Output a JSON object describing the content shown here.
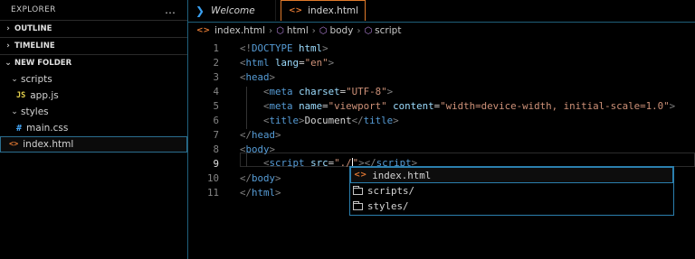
{
  "explorer": {
    "title": "EXPLORER",
    "more_icon": "…",
    "sections": {
      "outline": "OUTLINE",
      "timeline": "TIMELINE",
      "folder": "NEW FOLDER"
    },
    "tree": [
      {
        "label": "scripts",
        "type": "folder"
      },
      {
        "label": "app.js",
        "type": "js",
        "icon": "JS"
      },
      {
        "label": "styles",
        "type": "folder"
      },
      {
        "label": "main.css",
        "type": "css",
        "icon": "#"
      },
      {
        "label": "index.html",
        "type": "html",
        "icon": "<>"
      }
    ]
  },
  "tabs": [
    {
      "label": "Welcome",
      "icon": "vscode-icon"
    },
    {
      "label": "index.html",
      "icon": "html-icon",
      "modified": true
    }
  ],
  "breadcrumb": [
    "index.html",
    "html",
    "body",
    "script"
  ],
  "editor": {
    "lines": [
      {
        "n": "1",
        "html": "<span class='punc'>&lt;!</span><span class='tag'>DOCTYPE</span> <span class='attr'>html</span><span class='punc'>&gt;</span>"
      },
      {
        "n": "2",
        "html": "<span class='punc'>&lt;</span><span class='tag'>html</span> <span class='attr'>lang</span><span class='txt'>=</span><span class='val'>\"en\"</span><span class='punc'>&gt;</span>"
      },
      {
        "n": "3",
        "html": "<span class='punc'>&lt;</span><span class='tag'>head</span><span class='punc'>&gt;</span>"
      },
      {
        "n": "4",
        "html": "    <span class='punc'>&lt;</span><span class='tag'>meta</span> <span class='attr'>charset</span><span class='txt'>=</span><span class='val'>\"UTF-8\"</span><span class='punc'>&gt;</span>"
      },
      {
        "n": "5",
        "html": "    <span class='punc'>&lt;</span><span class='tag'>meta</span> <span class='attr'>name</span><span class='txt'>=</span><span class='val'>\"viewport\"</span> <span class='attr'>content</span><span class='txt'>=</span><span class='val'>\"width=device-width, initial-scale=1.0\"</span><span class='punc'>&gt;</span>"
      },
      {
        "n": "6",
        "html": "    <span class='punc'>&lt;</span><span class='tag'>title</span><span class='punc'>&gt;</span><span class='txt'>Document</span><span class='punc'>&lt;/</span><span class='tag'>title</span><span class='punc'>&gt;</span>"
      },
      {
        "n": "7",
        "html": "<span class='punc'>&lt;/</span><span class='tag'>head</span><span class='punc'>&gt;</span>"
      },
      {
        "n": "8",
        "html": "<span class='punc'>&lt;</span><span class='tag'>body</span><span class='punc'>&gt;</span>"
      },
      {
        "n": "9",
        "html": "    <span class='punc'>&lt;</span><span class='tag'>script</span> <span class='attr'>src</span><span class='txt'>=</span><span class='val'>\"./</span><span class='caret'></span><span class='val'>\"</span><span class='punc'>&gt;&lt;/</span><span class='tag'>script</span><span class='punc'>&gt;</span>"
      },
      {
        "n": "10",
        "html": "<span class='punc'>&lt;/</span><span class='tag'>body</span><span class='punc'>&gt;</span>"
      },
      {
        "n": "11",
        "html": "<span class='punc'>&lt;/</span><span class='tag'>html</span><span class='punc'>&gt;</span>"
      }
    ],
    "current_line": "9"
  },
  "suggestions": [
    {
      "label": "index.html",
      "icon": "html-icon"
    },
    {
      "label": "scripts/",
      "icon": "folder-icon"
    },
    {
      "label": "styles/",
      "icon": "folder-icon"
    }
  ],
  "colors": {
    "accent_border": "#2b7fae",
    "active_tab_border": "#e07a2b",
    "tag": "#569cd6",
    "attr": "#9cdcfe",
    "string": "#ce9178"
  }
}
